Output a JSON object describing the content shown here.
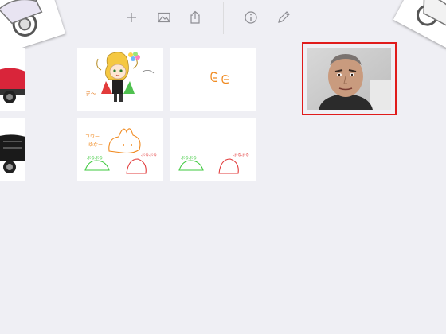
{
  "toolbar": {
    "icons": [
      "add-icon",
      "image-icon",
      "share-icon",
      "info-icon",
      "edit-pencil-icon"
    ],
    "icon_color": "#8e8e93"
  },
  "gallery": {
    "selected_border_color": "#e01b1b",
    "thumbnails": [
      {
        "name": "thumbnail-chibi-character",
        "texts": [
          "ま〜"
        ]
      },
      {
        "name": "thumbnail-orange-scribble",
        "texts": []
      },
      {
        "name": "thumbnail-bunny-slimes",
        "texts": [
          "フワー",
          "ゆなー",
          "ぷるぷる",
          "ぷるぷる"
        ]
      },
      {
        "name": "thumbnail-slimes",
        "texts": [
          "ぷるぷる",
          "ぷるぷる"
        ]
      }
    ]
  }
}
